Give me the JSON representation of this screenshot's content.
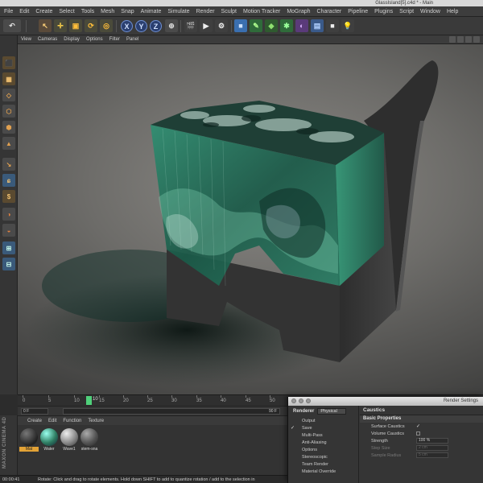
{
  "window": {
    "title": "GlassIsland[5].c4d * - Main"
  },
  "menu": [
    "File",
    "Edit",
    "Create",
    "Select",
    "Tools",
    "Mesh",
    "Snap",
    "Animate",
    "Simulate",
    "Render",
    "Sculpt",
    "Motion Tracker",
    "MoGraph",
    "Character",
    "Pipeline",
    "Plugins",
    "Script",
    "Window",
    "Help"
  ],
  "toolbar": {
    "axis_x": "X",
    "axis_y": "Y",
    "axis_z": "Z"
  },
  "viewport_menu": [
    "View",
    "Cameras",
    "Display",
    "Options",
    "Filter",
    "Panel"
  ],
  "timeline": {
    "ticks": [
      "0",
      "5",
      "10",
      "15",
      "20",
      "25",
      "30",
      "35",
      "40",
      "45",
      "50"
    ],
    "current_frame": "10",
    "start_field": "0 F",
    "end_field": "90 F"
  },
  "material_manager": {
    "menu": [
      "Create",
      "Edit",
      "Function",
      "Texture"
    ],
    "materials": [
      {
        "label": "Mat",
        "color": "#333333"
      },
      {
        "label": "Water",
        "color": "#2f7d62"
      },
      {
        "label": "Wave1",
        "color": "#8a8a8a"
      },
      {
        "label": "stem-sna",
        "color": "#555555"
      }
    ],
    "brand": "MAXON CINEMA 4D"
  },
  "status": {
    "time": "00:00:41",
    "message": "Rotate: Click and drag to rotate elements. Hold down SHIFT to add to quantize rotation / add to the selection in"
  },
  "render_settings": {
    "title": "Render Settings",
    "renderer_label": "Renderer",
    "renderer_value": "Physical",
    "items": [
      {
        "label": "Output",
        "checked": false
      },
      {
        "label": "Save",
        "checked": true
      },
      {
        "label": "Multi-Pass",
        "checked": false
      },
      {
        "label": "Anti-Aliasing",
        "checked": false
      },
      {
        "label": "Options",
        "checked": false
      },
      {
        "label": "Stereoscopic",
        "checked": false
      },
      {
        "label": "Team Render",
        "checked": false
      },
      {
        "label": "Material Override",
        "checked": false
      }
    ],
    "section_title": "Caustics",
    "sub_title": "Basic Properties",
    "props": [
      {
        "label": "Surface Caustics",
        "value": "✓",
        "dim": false
      },
      {
        "label": "Volume Caustics",
        "value": "",
        "dim": false
      },
      {
        "label": "Strength",
        "value": "100 %",
        "dim": false
      },
      {
        "label": "Step Size",
        "value": "2 cm",
        "dim": true
      },
      {
        "label": "Sample Radius",
        "value": "5 cm",
        "dim": true
      }
    ]
  }
}
